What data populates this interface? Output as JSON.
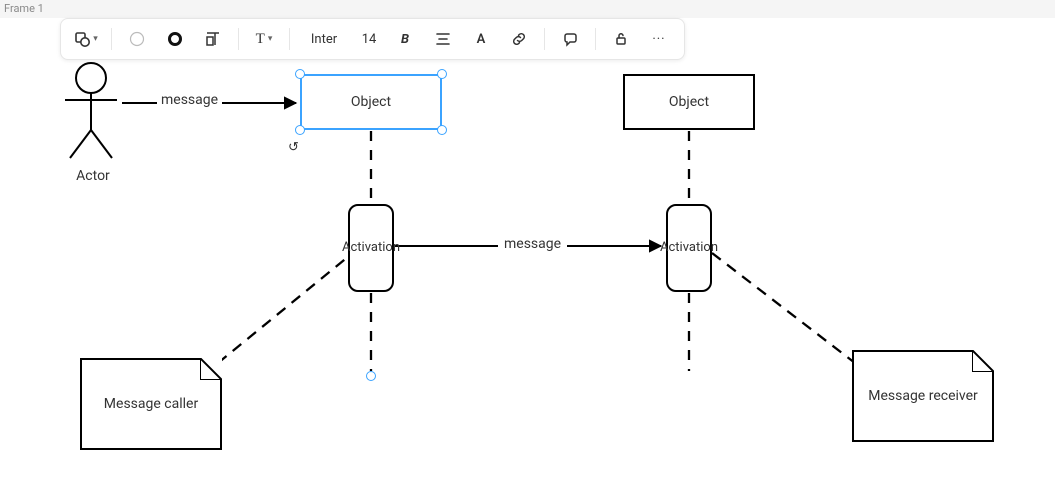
{
  "frame": {
    "label": "Frame 1"
  },
  "toolbar": {
    "font": "Inter",
    "font_size": "14",
    "bold": "B",
    "text_style": "A"
  },
  "diagram": {
    "actor_label": "Actor",
    "object1_label": "Object",
    "object2_label": "Object",
    "activation1_label": "Activation",
    "activation2_label": "Activation",
    "message1_label": "message",
    "message2_label": "message",
    "note_left_label": "Message caller",
    "note_right_label": "Message receiver"
  }
}
